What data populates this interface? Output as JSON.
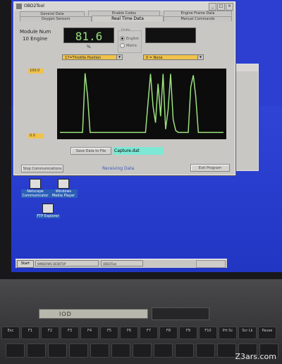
{
  "window": {
    "title": "OBD2Tool",
    "controls": [
      "_",
      "□",
      "×"
    ]
  },
  "tabs": {
    "row1": [
      "General Data",
      "Enable Codes",
      "Engine Frame Data"
    ],
    "row2": [
      "Oxygen Sensors",
      "Real Time Data",
      "Manual Commands"
    ]
  },
  "module": {
    "label": "Module Num",
    "value": "10 Engine"
  },
  "readout": {
    "value": "81.6",
    "unit": "%"
  },
  "units": {
    "title": "Units",
    "options": [
      "English",
      "Metric"
    ],
    "selected": "English"
  },
  "pid_select_1": {
    "value": "17=Throttle Position"
  },
  "pid_select_2": {
    "value": "0 = None"
  },
  "graph": {
    "scale_max": "100.0",
    "scale_min": "0.0",
    "trace_color": "#9be07e",
    "background": "#0c0c0c",
    "trace_values": [
      5,
      5,
      5,
      5,
      5,
      5,
      5,
      5,
      5,
      5,
      96,
      60,
      5,
      5,
      5,
      5,
      5,
      5,
      5,
      5,
      5,
      5,
      5,
      5,
      5,
      5,
      5,
      5,
      5,
      5,
      5,
      5,
      5,
      5,
      5,
      50,
      95,
      45,
      20,
      80,
      30,
      95,
      10,
      40,
      95,
      25,
      8,
      5,
      5,
      5,
      5,
      5,
      75,
      93,
      60,
      5,
      5,
      5,
      5,
      5,
      5,
      5,
      5,
      5,
      5,
      5
    ]
  },
  "buttons": {
    "save": "Save Data to File",
    "stop": "Stop Communications",
    "exit": "Exit Program"
  },
  "file": {
    "name": "Capture.dat"
  },
  "status": {
    "text": "Receiving Data"
  },
  "desktop_icons": [
    {
      "label": "Netscape Communicator",
      "icon": "netscape-icon"
    },
    {
      "label": "Windows Media Player",
      "icon": "media-player-icon"
    },
    {
      "label": "FTP Explorer",
      "icon": "ftp-icon"
    }
  ],
  "taskbar": {
    "start": "Start",
    "items": [
      "WINDOWS DESKTOP",
      "OBD2Tool"
    ]
  },
  "keyboard": {
    "lcd_text": "IOD",
    "keys": [
      "Esc",
      "F1",
      "F2",
      "F3",
      "F4",
      "F5",
      "F6",
      "F7",
      "F8",
      "F9",
      "F10",
      "Prt Sc",
      "Scr Lk",
      "Pause"
    ]
  },
  "watermark": "Z3ars.com"
}
